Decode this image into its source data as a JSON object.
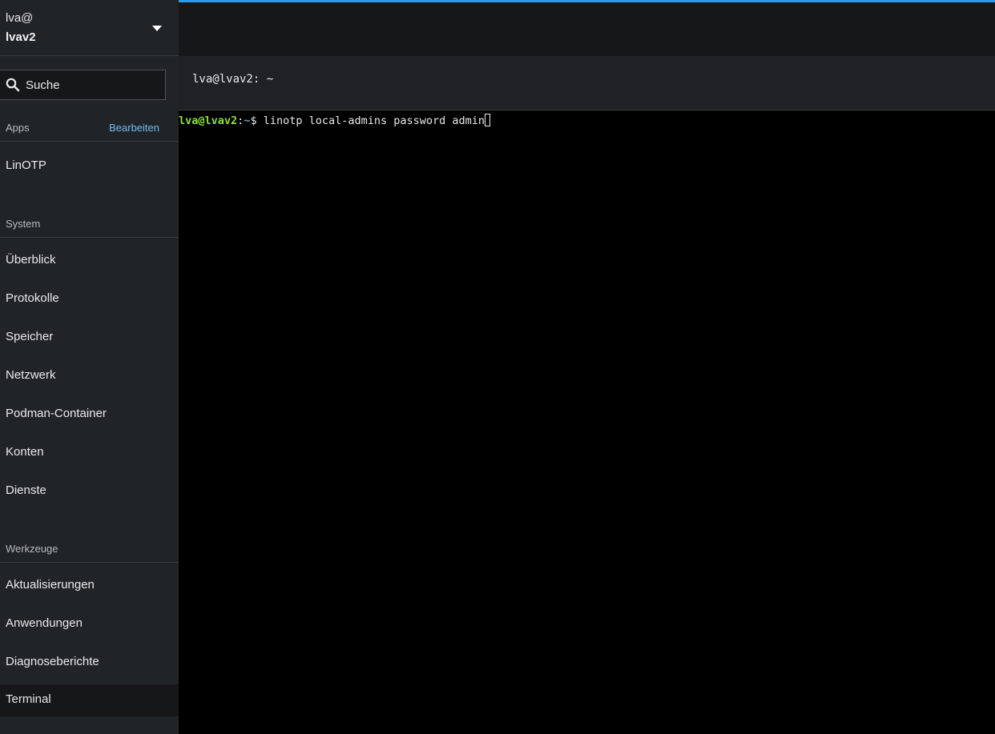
{
  "host": {
    "user": "lva@",
    "name": "lvav2",
    "icon": "chevron-down-icon"
  },
  "search": {
    "placeholder": "Suche",
    "icon": "search-icon"
  },
  "sections": {
    "apps": {
      "title": "Apps",
      "action": "Bearbeiten",
      "items": [
        "LinOTP"
      ]
    },
    "system": {
      "title": "System",
      "items": [
        "Überblick",
        "Protokolle",
        "Speicher",
        "Netzwerk",
        "Podman-Container",
        "Konten",
        "Dienste"
      ]
    },
    "tools": {
      "title": "Werkzeuge",
      "items": [
        "Aktualisierungen",
        "Anwendungen",
        "Diagnoseberichte",
        "Terminal"
      ]
    }
  },
  "active_item": "Terminal",
  "terminal": {
    "title": "lva@lvav2: ~",
    "prompt_user": "lva@lvav2",
    "prompt_sep": ":",
    "prompt_path": "~",
    "prompt_symbol": "$ ",
    "command": "linotp local-admins password admin"
  },
  "colors": {
    "accent": "#2b9af3",
    "link": "#73bcf7",
    "sidebar_bg": "#212427",
    "prompt_user": "#8ae234",
    "prompt_path": "#729fcf"
  }
}
